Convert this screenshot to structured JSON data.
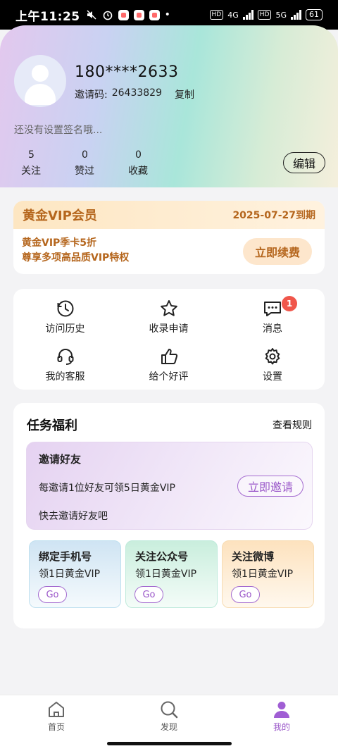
{
  "status_bar": {
    "time": "上午11:25",
    "net_labels": [
      "4G",
      "5G"
    ],
    "hd_label": "HD",
    "battery": "61"
  },
  "profile": {
    "phone": "180****2633",
    "invite_label": "邀请码:",
    "invite_code": "26433829",
    "copy_label": "复制",
    "signature_placeholder": "还没有设置签名哦...",
    "stats": [
      {
        "count": "5",
        "label": "关注"
      },
      {
        "count": "0",
        "label": "赞过"
      },
      {
        "count": "0",
        "label": "收藏"
      }
    ],
    "edit_label": "编辑"
  },
  "vip": {
    "title": "黄金VIP会员",
    "expire": "2025-07-27到期",
    "promo_line1": "黄金VIP季卡5折",
    "promo_line2": "尊享多项高品质VIP特权",
    "renew_label": "立即续费",
    "accent_color": "#b5661d"
  },
  "menu": {
    "items": [
      {
        "label": "访问历史",
        "icon": "history-icon"
      },
      {
        "label": "收录申请",
        "icon": "star-icon"
      },
      {
        "label": "消息",
        "icon": "message-icon",
        "badge": "1"
      },
      {
        "label": "我的客服",
        "icon": "headset-icon"
      },
      {
        "label": "给个好评",
        "icon": "thumbs-up-icon"
      },
      {
        "label": "设置",
        "icon": "gear-icon"
      }
    ]
  },
  "tasks": {
    "title": "任务福利",
    "rules_label": "查看规则",
    "invite": {
      "title": "邀请好友",
      "desc": "每邀请1位好友可领5日黄金VIP",
      "sub": "快去邀请好友吧",
      "button": "立即邀请"
    },
    "mini": [
      {
        "title": "绑定手机号",
        "desc": "领1日黄金VIP",
        "button": "Go"
      },
      {
        "title": "关注公众号",
        "desc": "领1日黄金VIP",
        "button": "Go"
      },
      {
        "title": "关注微博",
        "desc": "领1日黄金VIP",
        "button": "Go"
      }
    ],
    "accent_color": "#9a57c9"
  },
  "bottom_nav": {
    "items": [
      {
        "label": "首页",
        "icon": "home-icon"
      },
      {
        "label": "发现",
        "icon": "discover-icon"
      },
      {
        "label": "我的",
        "icon": "profile-icon",
        "active": true
      }
    ]
  }
}
